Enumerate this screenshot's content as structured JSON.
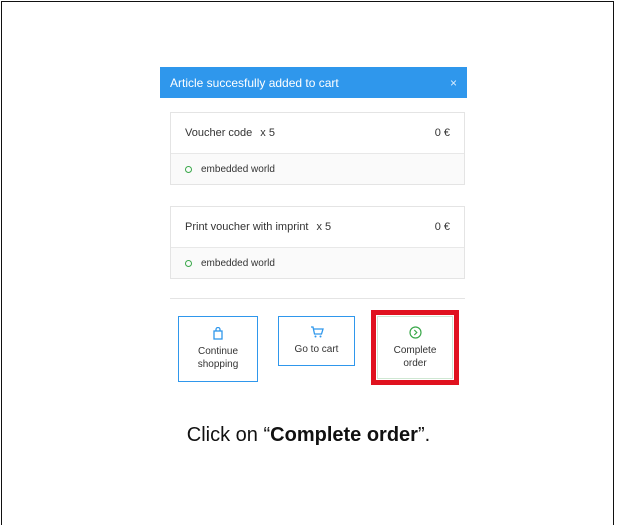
{
  "banner": {
    "text": "Article succesfully added to cart",
    "close": "×"
  },
  "items": [
    {
      "name": "Voucher code",
      "qty": "x 5",
      "price": "0 €",
      "variant": "embedded world"
    },
    {
      "name": "Print voucher with imprint",
      "qty": "x 5",
      "price": "0 €",
      "variant": "embedded world"
    }
  ],
  "actions": {
    "continue": {
      "line1": "Continue",
      "line2": "shopping",
      "icon": "shopping-bag-icon"
    },
    "cart": {
      "label": "Go to cart",
      "icon": "shopping-cart-icon"
    },
    "complete": {
      "line1": "Complete",
      "line2": "order",
      "icon": "chevron-circle-icon"
    }
  },
  "caption": {
    "prefix": "Click on “",
    "bold": "Complete order",
    "suffix": "”."
  },
  "colors": {
    "accent": "#2f97ec",
    "success": "#3aa84a",
    "highlight": "#e0121f"
  }
}
